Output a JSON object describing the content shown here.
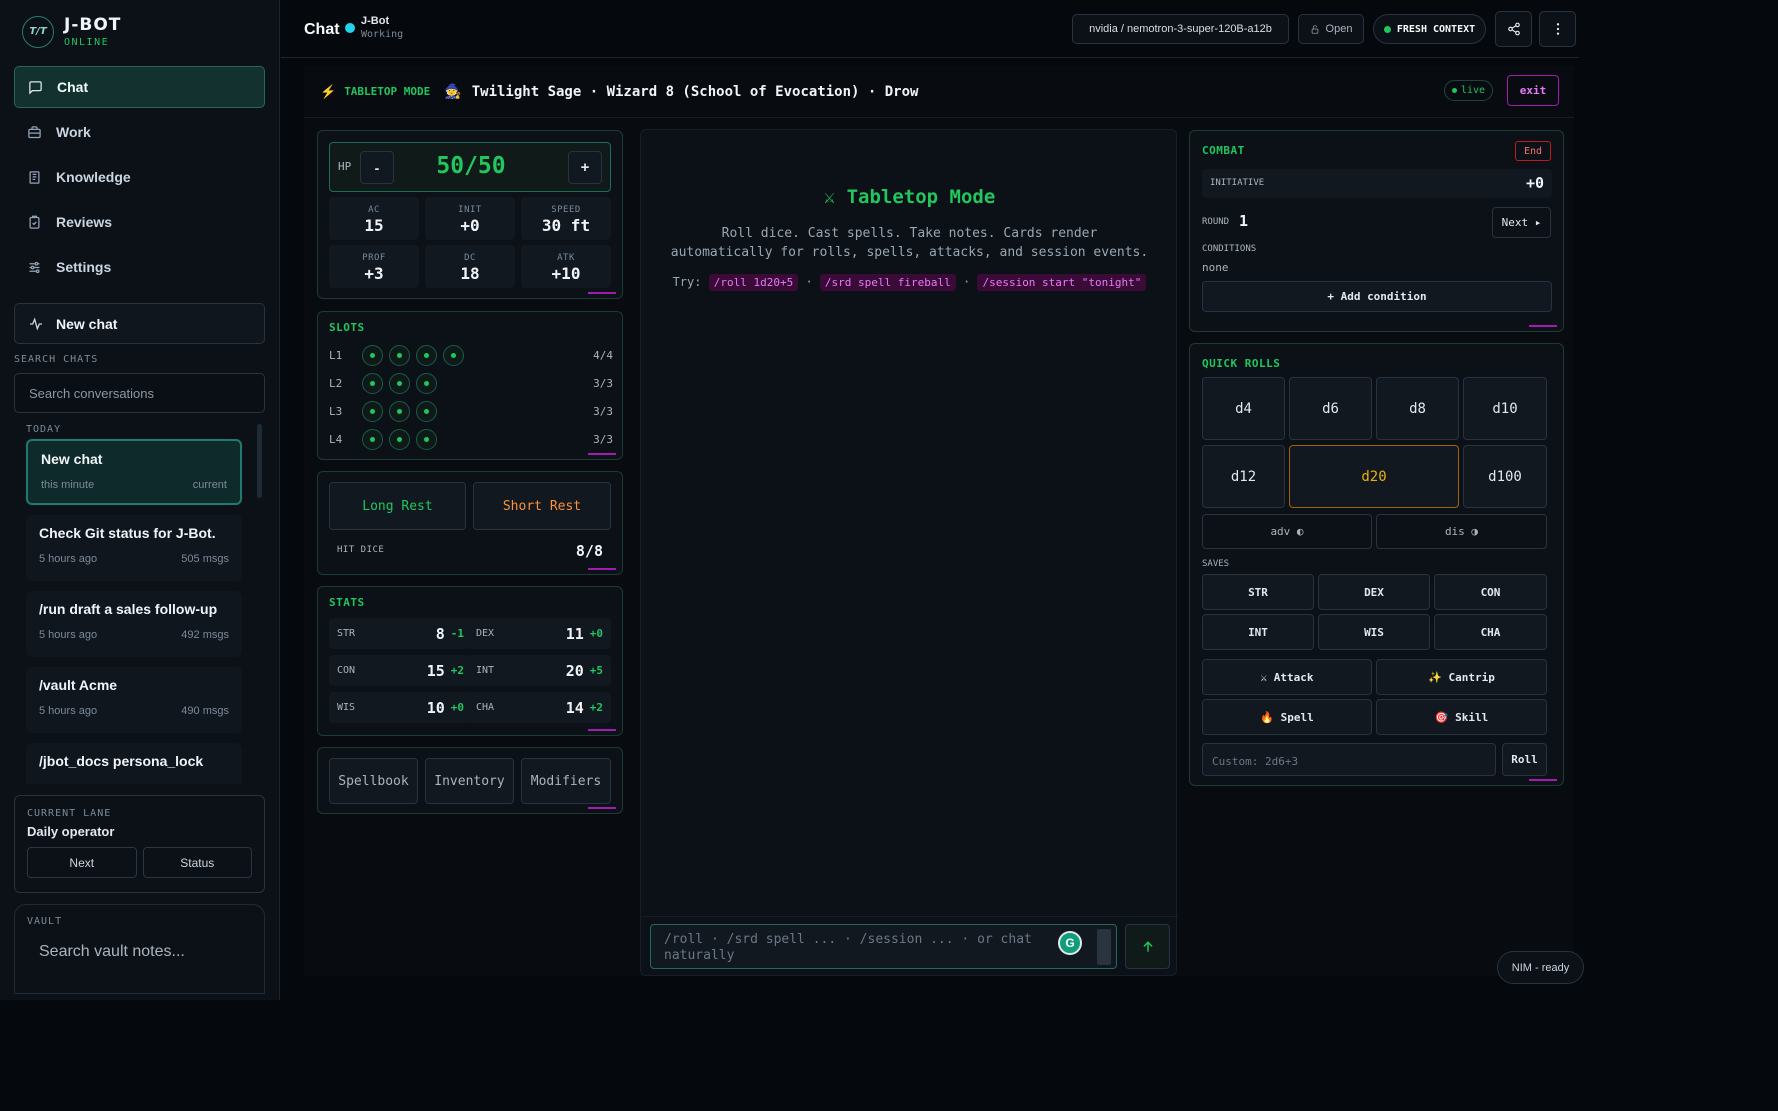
{
  "brand": {
    "logo": "T/T",
    "name": "J-BOT",
    "status": "ONLINE"
  },
  "nav": [
    {
      "label": "Chat",
      "icon": "chat-bubble-icon"
    },
    {
      "label": "Work",
      "icon": "briefcase-icon"
    },
    {
      "label": "Knowledge",
      "icon": "book-icon"
    },
    {
      "label": "Reviews",
      "icon": "clipboard-check-icon"
    },
    {
      "label": "Settings",
      "icon": "sliders-icon"
    }
  ],
  "new_chat": "New chat",
  "search_chats": {
    "label": "SEARCH CHATS",
    "placeholder": "Search conversations"
  },
  "chats": {
    "group": "TODAY",
    "items": [
      {
        "title": "New chat",
        "time": "this minute",
        "meta": "current"
      },
      {
        "title": "Check Git status for J-Bot.",
        "time": "5 hours ago",
        "meta": "505 msgs"
      },
      {
        "title": "/run draft a sales follow-up",
        "time": "5 hours ago",
        "meta": "492 msgs"
      },
      {
        "title": "/vault Acme",
        "time": "5 hours ago",
        "meta": "490 msgs"
      },
      {
        "title": "/jbot_docs persona_lock",
        "time": "",
        "meta": ""
      }
    ]
  },
  "lane": {
    "label": "CURRENT LANE",
    "title": "Daily operator",
    "next": "Next",
    "status": "Status"
  },
  "vault": {
    "label": "VAULT",
    "placeholder": "Search vault notes..."
  },
  "topbar": {
    "title": "Chat",
    "bot_name": "J-Bot",
    "bot_state": "Working",
    "model": "nvidia / nemotron-3-super-120B-a12b",
    "open": "Open",
    "context": "FRESH CONTEXT"
  },
  "mode": {
    "label": "TABLETOP MODE",
    "character": "Twilight Sage · Wizard 8 (School of Evocation) · Drow",
    "live": "live",
    "exit": "exit"
  },
  "vitals": {
    "hp_label": "HP",
    "hp": "50/50",
    "minus": "-",
    "plus": "+",
    "cells": [
      {
        "k": "AC",
        "v": "15"
      },
      {
        "k": "INIT",
        "v": "+0"
      },
      {
        "k": "SPEED",
        "v": "30 ft"
      },
      {
        "k": "PROF",
        "v": "+3"
      },
      {
        "k": "DC",
        "v": "18"
      },
      {
        "k": "ATK",
        "v": "+10"
      }
    ]
  },
  "slots": {
    "title": "SLOTS",
    "rows": [
      {
        "level": "L1",
        "count": "4/4",
        "available": 4
      },
      {
        "level": "L2",
        "count": "3/3",
        "available": 3
      },
      {
        "level": "L3",
        "count": "3/3",
        "available": 3
      },
      {
        "level": "L4",
        "count": "3/3",
        "available": 3
      }
    ]
  },
  "rest": {
    "long": "Long Rest",
    "short": "Short Rest",
    "hit_dice_label": "HIT DICE",
    "hit_dice": "8/8"
  },
  "stats": {
    "title": "STATS",
    "items": [
      {
        "k": "STR",
        "v": "8",
        "m": "-1"
      },
      {
        "k": "DEX",
        "v": "11",
        "m": "+0"
      },
      {
        "k": "CON",
        "v": "15",
        "m": "+2"
      },
      {
        "k": "INT",
        "v": "20",
        "m": "+5"
      },
      {
        "k": "WIS",
        "v": "10",
        "m": "+0"
      },
      {
        "k": "CHA",
        "v": "14",
        "m": "+2"
      }
    ]
  },
  "tabs": [
    "Spellbook",
    "Inventory",
    "Modifiers"
  ],
  "center": {
    "title": "Tabletop Mode",
    "line1": "Roll dice. Cast spells. Take notes. Cards render",
    "line2": "automatically for rolls, spells, attacks, and session events.",
    "try": "Try:",
    "chips": [
      "/roll 1d20+5",
      "/srd spell fireball",
      "/session start \"tonight\""
    ],
    "sep": "·",
    "input_placeholder": "/roll · /srd spell ... · /session ... · or chat naturally"
  },
  "combat": {
    "title": "COMBAT",
    "end": "End",
    "initiative_label": "INITIATIVE",
    "initiative": "+0",
    "round_label": "ROUND",
    "round": "1",
    "next": "Next ▸",
    "conditions_label": "CONDITIONS",
    "conditions": "none",
    "add": "+ Add condition"
  },
  "quick": {
    "title": "QUICK ROLLS",
    "dice": [
      "d4",
      "d6",
      "d8",
      "d10",
      "d12",
      "d20",
      "d100"
    ],
    "adv": "adv ◐",
    "dis": "dis ◑",
    "saves_label": "SAVES",
    "saves": [
      "STR",
      "DEX",
      "CON",
      "INT",
      "WIS",
      "CHA"
    ],
    "actions": [
      "⚔ Attack",
      "✨ Cantrip",
      "🔥 Spell",
      "🎯 Skill"
    ],
    "custom_placeholder": "Custom: 2d6+3",
    "roll": "Roll"
  },
  "status": "NIM - ready",
  "colors": {
    "accent": "#22c55e",
    "teal": "#1f7a70",
    "magenta": "#e879f9",
    "gold": "#eab308",
    "orange": "#fb923c",
    "bg": "#05080c"
  }
}
